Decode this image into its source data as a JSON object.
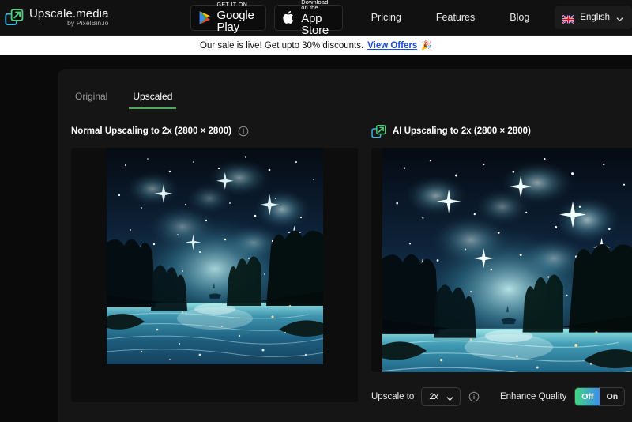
{
  "header": {
    "brand": {
      "logo_icon": "upscale-expand-arrow-icon",
      "name": "Upscale.media",
      "subtitle": "by PixelBin.io"
    },
    "store_buttons": [
      {
        "icon": "google-play-icon",
        "small_text": "GET IT ON",
        "big_text": "Google Play"
      },
      {
        "icon": "apple-logo-icon",
        "small_text": "Download on the",
        "big_text": "App Store"
      }
    ],
    "nav_links": [
      "Pricing",
      "Features",
      "Blog"
    ],
    "language": {
      "flag_icon": "uk-flag-icon",
      "label": "English",
      "chevron_icon": "chevron-down-icon"
    }
  },
  "banner": {
    "text": "Our sale is live! Get upto 30% discounts.",
    "link_label": "View Offers",
    "emoji": "🎉"
  },
  "tabs": [
    {
      "label": "Original",
      "active": false
    },
    {
      "label": "Upscaled",
      "active": true
    }
  ],
  "panels": {
    "left": {
      "title": "Normal Upscaling to 2x (2800 × 2800)",
      "info_icon": "info-circle-icon",
      "image_alt": "starry-night-river-landscape"
    },
    "right": {
      "leading_icon": "upscale-expand-arrow-icon",
      "title": "AI Upscaling to 2x (2800 × 2800)",
      "image_alt": "starry-night-river-landscape-upscaled"
    }
  },
  "controls": {
    "upscale_to_label": "Upscale to",
    "upscale_to_value": "2x",
    "upscale_to_chevron": "chevron-down-icon",
    "upscale_info_icon": "info-circle-icon",
    "enhance_quality_label": "Enhance Quality",
    "enhance_off_label": "Off",
    "enhance_on_label": "On",
    "enhance_selected": "Off",
    "enhance_info_icon": "info-circle-icon"
  },
  "colors": {
    "page_bg": "#0a0a0a",
    "header_bg": "#111111",
    "panel_bg": "#151515",
    "banner_bg": "#ffffff",
    "banner_link": "#1a4ed8",
    "tab_active_underline": "#4ea95f",
    "toggle_gradient_start": "#41d67e",
    "toggle_gradient_end": "#3c8ef0"
  }
}
